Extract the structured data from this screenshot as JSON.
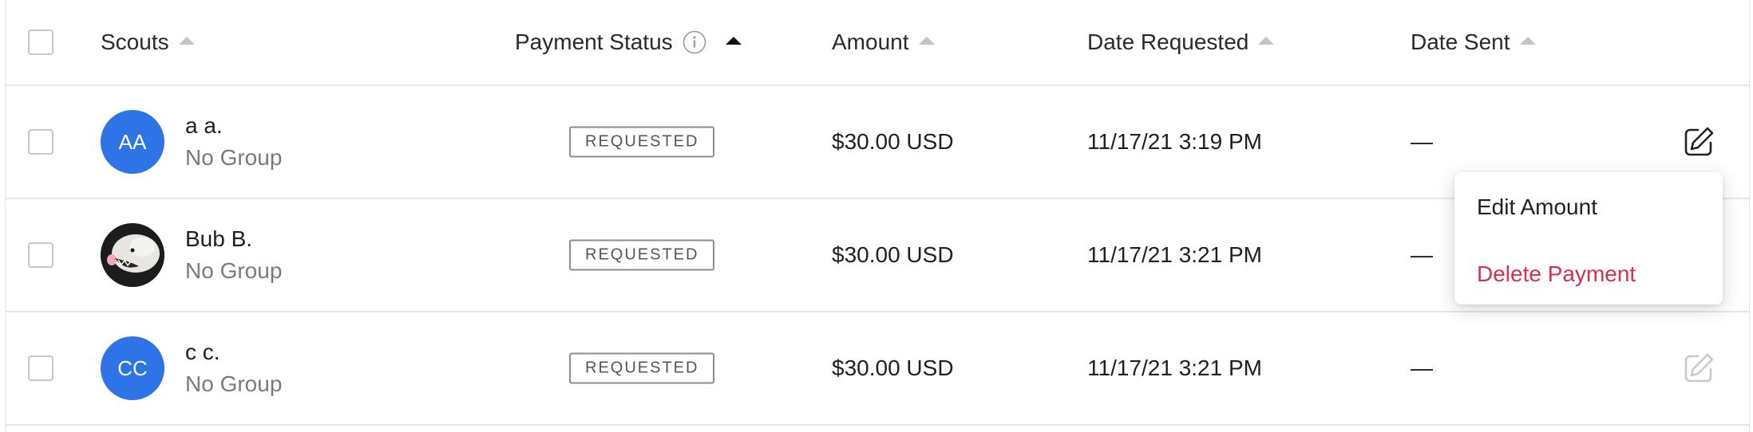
{
  "header": {
    "columns": [
      {
        "label": "Scouts",
        "sort": "up"
      },
      {
        "label": "Payment Status",
        "sort": "up-active",
        "info_icon": "info-icon"
      },
      {
        "label": "Amount",
        "sort": "up"
      },
      {
        "label": "Date Requested",
        "sort": "up"
      },
      {
        "label": "Date Sent",
        "sort": "up"
      }
    ]
  },
  "rows": [
    {
      "avatar_initials": "AA",
      "avatar_color": "#2e74e6",
      "name": "a a.",
      "group": "No Group",
      "status": "REQUESTED",
      "amount": "$30.00 USD",
      "date_requested": "11/17/21 3:19 PM",
      "date_sent": "—",
      "edit_icon": "edit-icon"
    },
    {
      "avatar_initials": "",
      "avatar_image": "opossum-photo",
      "name": "Bub B.",
      "group": "No Group",
      "status": "REQUESTED",
      "amount": "$30.00 USD",
      "date_requested": "11/17/21 3:21 PM",
      "date_sent": "—",
      "edit_icon": "edit-icon"
    },
    {
      "avatar_initials": "CC",
      "avatar_color": "#2e74e6",
      "name": "c c.",
      "group": "No Group",
      "status": "REQUESTED",
      "amount": "$30.00 USD",
      "date_requested": "11/17/21 3:21 PM",
      "date_sent": "—",
      "edit_icon": "edit-icon"
    }
  ],
  "menu": {
    "edit_amount": "Edit Amount",
    "delete_payment": "Delete Payment",
    "delete_color": "#d6304d"
  }
}
